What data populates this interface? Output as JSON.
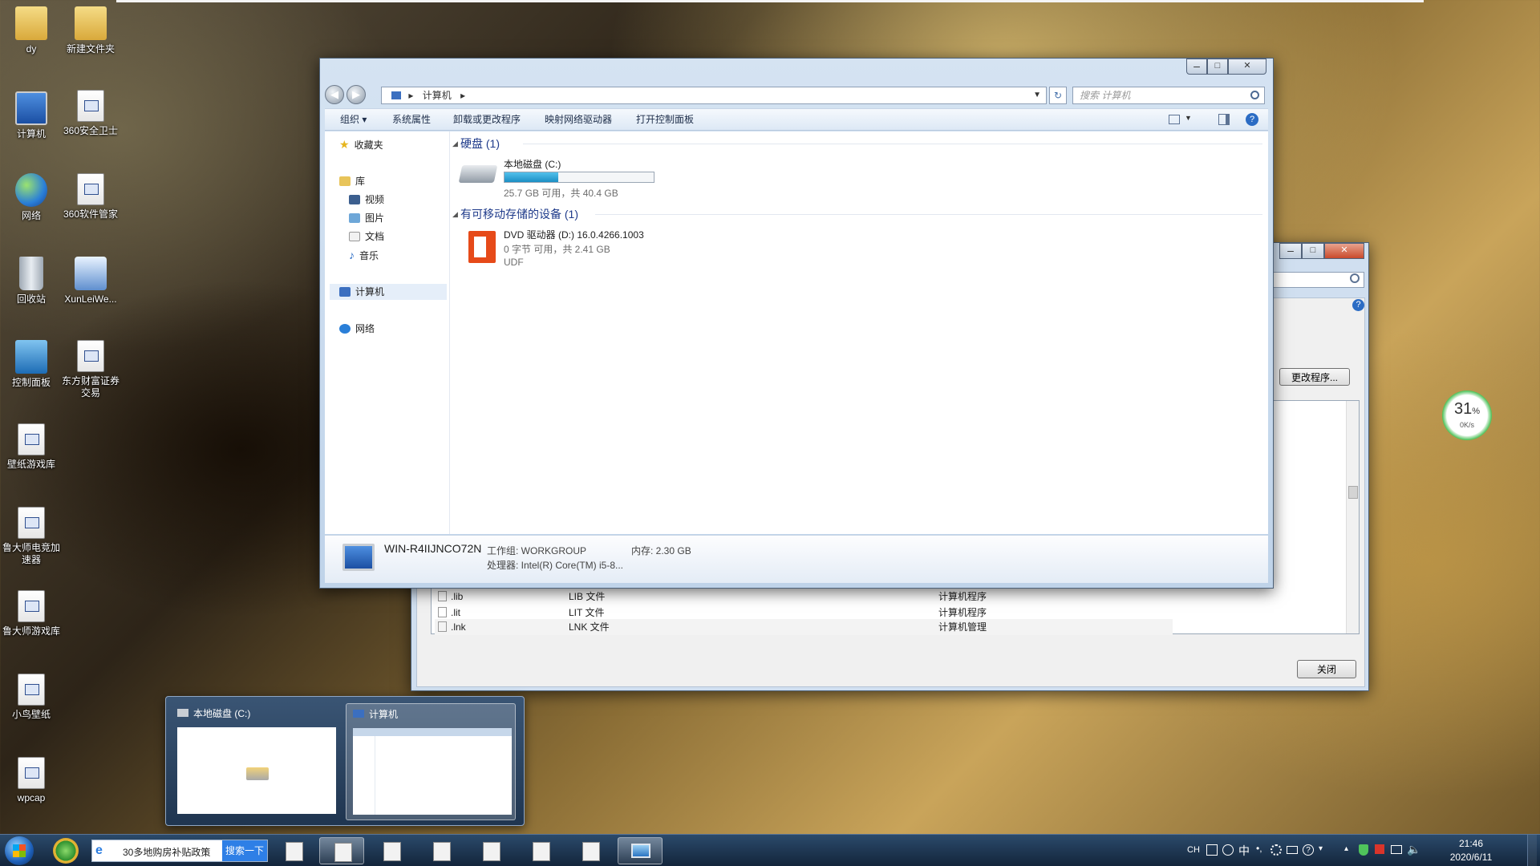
{
  "desktop": {
    "icons": [
      {
        "label": "dy",
        "icon": "user-folder-icon"
      },
      {
        "label": "新建文件夹",
        "icon": "folder-icon"
      },
      {
        "label": "计算机",
        "icon": "computer-icon"
      },
      {
        "label": "360安全卫士",
        "icon": "file-icon"
      },
      {
        "label": "网络",
        "icon": "network-globe-icon"
      },
      {
        "label": "360软件管家",
        "icon": "file-icon"
      },
      {
        "label": "回收站",
        "icon": "recycle-bin-icon"
      },
      {
        "label": "XunLeiWe...",
        "icon": "shield-icon"
      },
      {
        "label": "控制面板",
        "icon": "control-panel-icon"
      },
      {
        "label": "东方财富证券交易",
        "icon": "file-icon"
      },
      {
        "label": "壁纸游戏库",
        "icon": "file-icon"
      },
      {
        "label": "鲁大师电竞加速器",
        "icon": "file-icon"
      },
      {
        "label": "鲁大师游戏库",
        "icon": "file-icon"
      },
      {
        "label": "小鸟壁纸",
        "icon": "file-icon"
      },
      {
        "label": "wpcap",
        "icon": "file-icon"
      }
    ]
  },
  "explorer": {
    "window_controls": {
      "minimize": "–",
      "maximize": "□",
      "close": "✕"
    },
    "address": {
      "root": "计算机"
    },
    "search_placeholder": "搜索 计算机",
    "toolbar": {
      "organize": "组织 ▾",
      "system_properties": "系统属性",
      "uninstall": "卸载或更改程序",
      "map_drive": "映射网络驱动器",
      "control_panel": "打开控制面板"
    },
    "nav": {
      "favorites": "收藏夹",
      "libraries": "库",
      "videos": "视频",
      "pictures": "图片",
      "documents": "文档",
      "music": "音乐",
      "computer": "计算机",
      "network": "网络"
    },
    "groups": {
      "hard_disks": "硬盘 (1)",
      "removable": "有可移动存储的设备 (1)"
    },
    "drive_c": {
      "name": "本地磁盘 (C:)",
      "free_text": "25.7 GB 可用，共 40.4 GB",
      "used_fraction": 0.36
    },
    "drive_d": {
      "name": "DVD 驱动器 (D:) 16.0.4266.1003",
      "free_text": "0 字节 可用，共 2.41 GB",
      "fs": "UDF"
    },
    "details": {
      "pc_name": "WIN-R4IIJNCO72N",
      "workgroup": "工作组: WORKGROUP",
      "memory": "内存: 2.30 GB",
      "processor": "处理器: Intel(R) Core(TM) i5-8..."
    }
  },
  "dialog": {
    "change_program": "更改程序...",
    "close": "关闭",
    "rows": [
      {
        "ext": ".lib",
        "type": "LIB 文件",
        "program": "计算机程序"
      },
      {
        "ext": ".lit",
        "type": "LIT 文件",
        "program": "计算机程序"
      },
      {
        "ext": ".lnk",
        "type": "LNK 文件",
        "program": "计算机管理"
      }
    ]
  },
  "gauge": {
    "percent": "31",
    "unit": "%",
    "speed": "0K/s"
  },
  "preview": {
    "items": [
      {
        "title": "本地磁盘 (C:)"
      },
      {
        "title": "计算机"
      }
    ]
  },
  "taskbar": {
    "ie_text": "30多地购房补贴政策",
    "search_button": "搜索一下",
    "tray": {
      "lang": "CH",
      "ime": "中",
      "time": "21:46",
      "date": "2020/6/11"
    }
  }
}
